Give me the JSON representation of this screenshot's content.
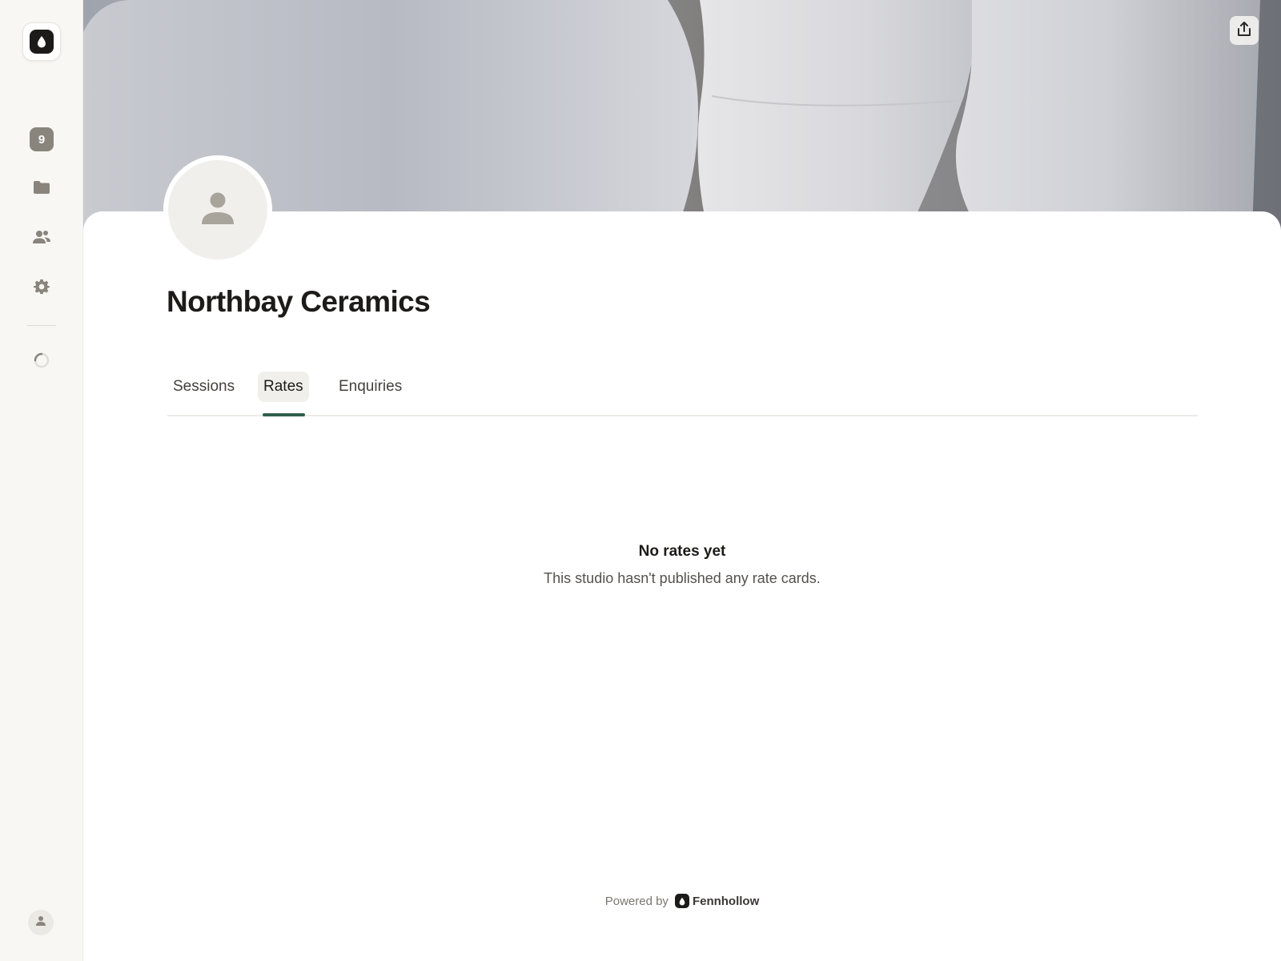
{
  "sidebar": {
    "logo_icon": "droplet-icon",
    "items": [
      {
        "name": "notifications",
        "badge": "9"
      },
      {
        "name": "projects",
        "icon": "folder-icon"
      },
      {
        "name": "people",
        "icon": "users-icon"
      },
      {
        "name": "settings",
        "icon": "gear-icon"
      },
      {
        "name": "status",
        "icon": "loading-spinner-icon"
      }
    ],
    "account_icon": "user-icon"
  },
  "cover": {
    "share_icon": "share-upload-icon"
  },
  "profile": {
    "title": "Northbay Ceramics",
    "avatar_icon": "user-placeholder-icon"
  },
  "tabs": [
    {
      "label": "Sessions",
      "active": false
    },
    {
      "label": "Rates",
      "active": true
    },
    {
      "label": "Enquiries",
      "active": false
    }
  ],
  "empty_state": {
    "title": "No rates yet",
    "message": "This studio hasn't published any rate cards."
  },
  "footer": {
    "powered_by": "Powered by",
    "brand": "Fennhollow"
  },
  "colors": {
    "accent": "#2f5f4d",
    "sidebar_bg": "#f8f7f3",
    "text_primary": "#1c1b19",
    "badge_bg": "#8a857c"
  }
}
